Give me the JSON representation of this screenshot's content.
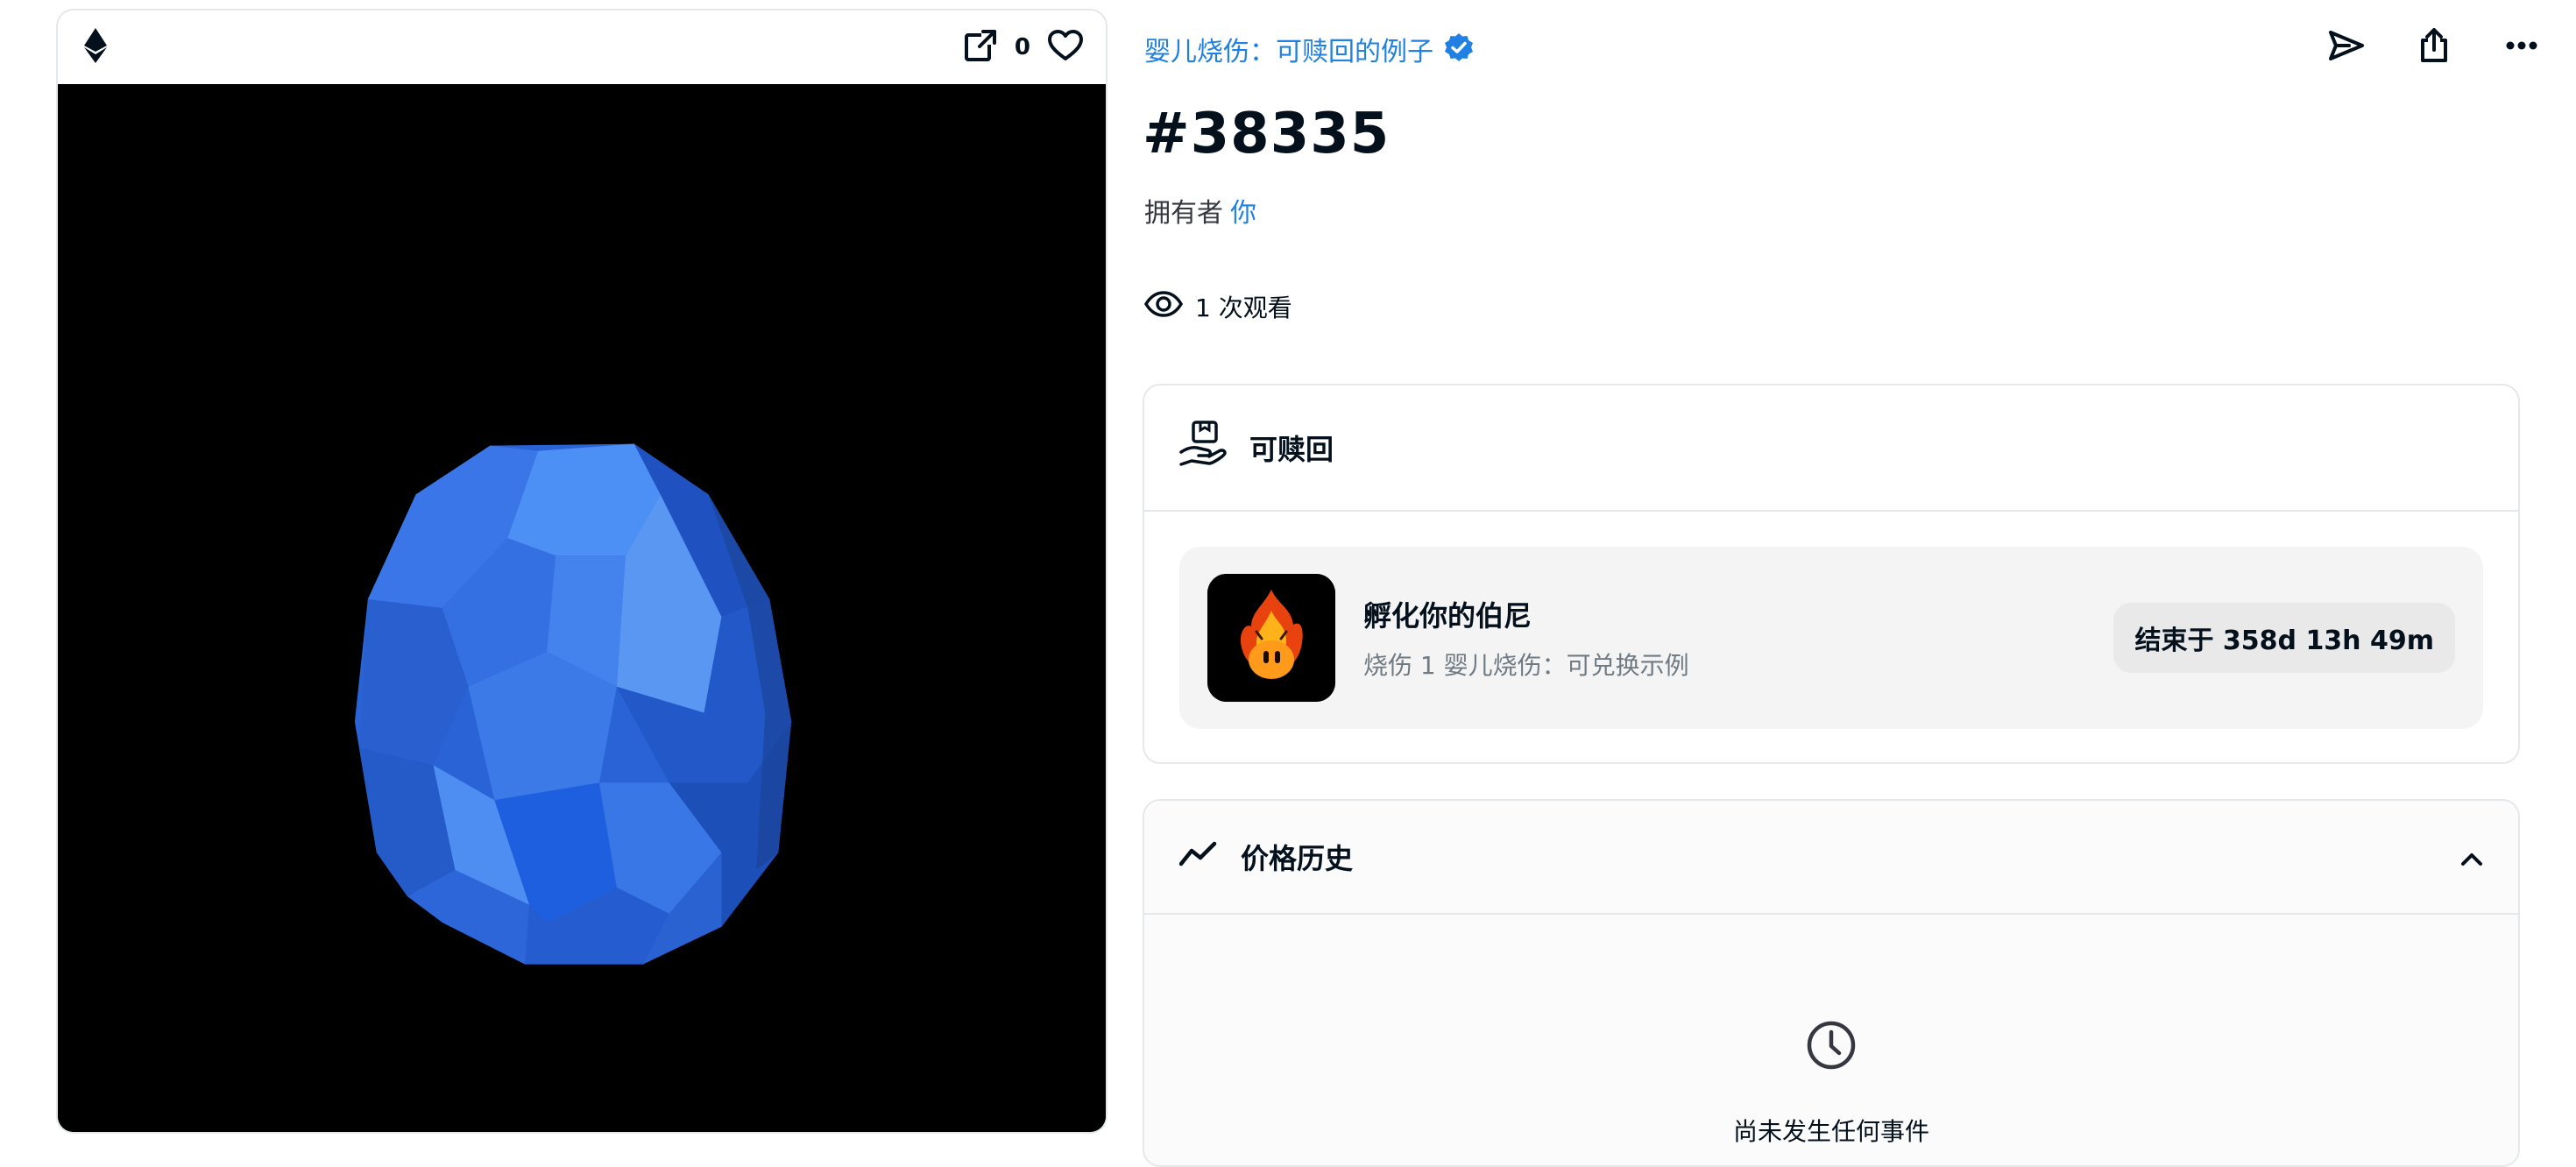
{
  "media": {
    "favorite_count": "0"
  },
  "collection": {
    "name": "婴儿烧伤：可赎回的例子",
    "verified": true
  },
  "token": {
    "title": "#38335",
    "owner_label": "拥有者",
    "owner_value": "你",
    "views_text": "1 次观看"
  },
  "redeemable": {
    "header": "可赎回",
    "item_name": "孵化你的伯尼",
    "item_desc": "烧伤 1 婴儿烧伤：可兑换示例",
    "status": "结束于 358d 13h 49m"
  },
  "price_history": {
    "header": "价格历史",
    "empty_message": "尚未发生任何事件"
  },
  "colors": {
    "accent_blue": "#2081e2",
    "egg_blue": "#2f6fe6",
    "border": "#e5e8eb",
    "text_primary": "#04111d"
  },
  "icons": {
    "chain": "ethereum-icon",
    "open_external": "external-link-icon",
    "favorite": "heart-icon",
    "transfer": "send-icon",
    "share": "share-icon",
    "more": "more-icon",
    "views": "eye-icon",
    "redeem": "redeem-hand-icon",
    "price": "trend-line-icon",
    "collapse": "chevron-up-icon",
    "empty": "clock-icon"
  }
}
